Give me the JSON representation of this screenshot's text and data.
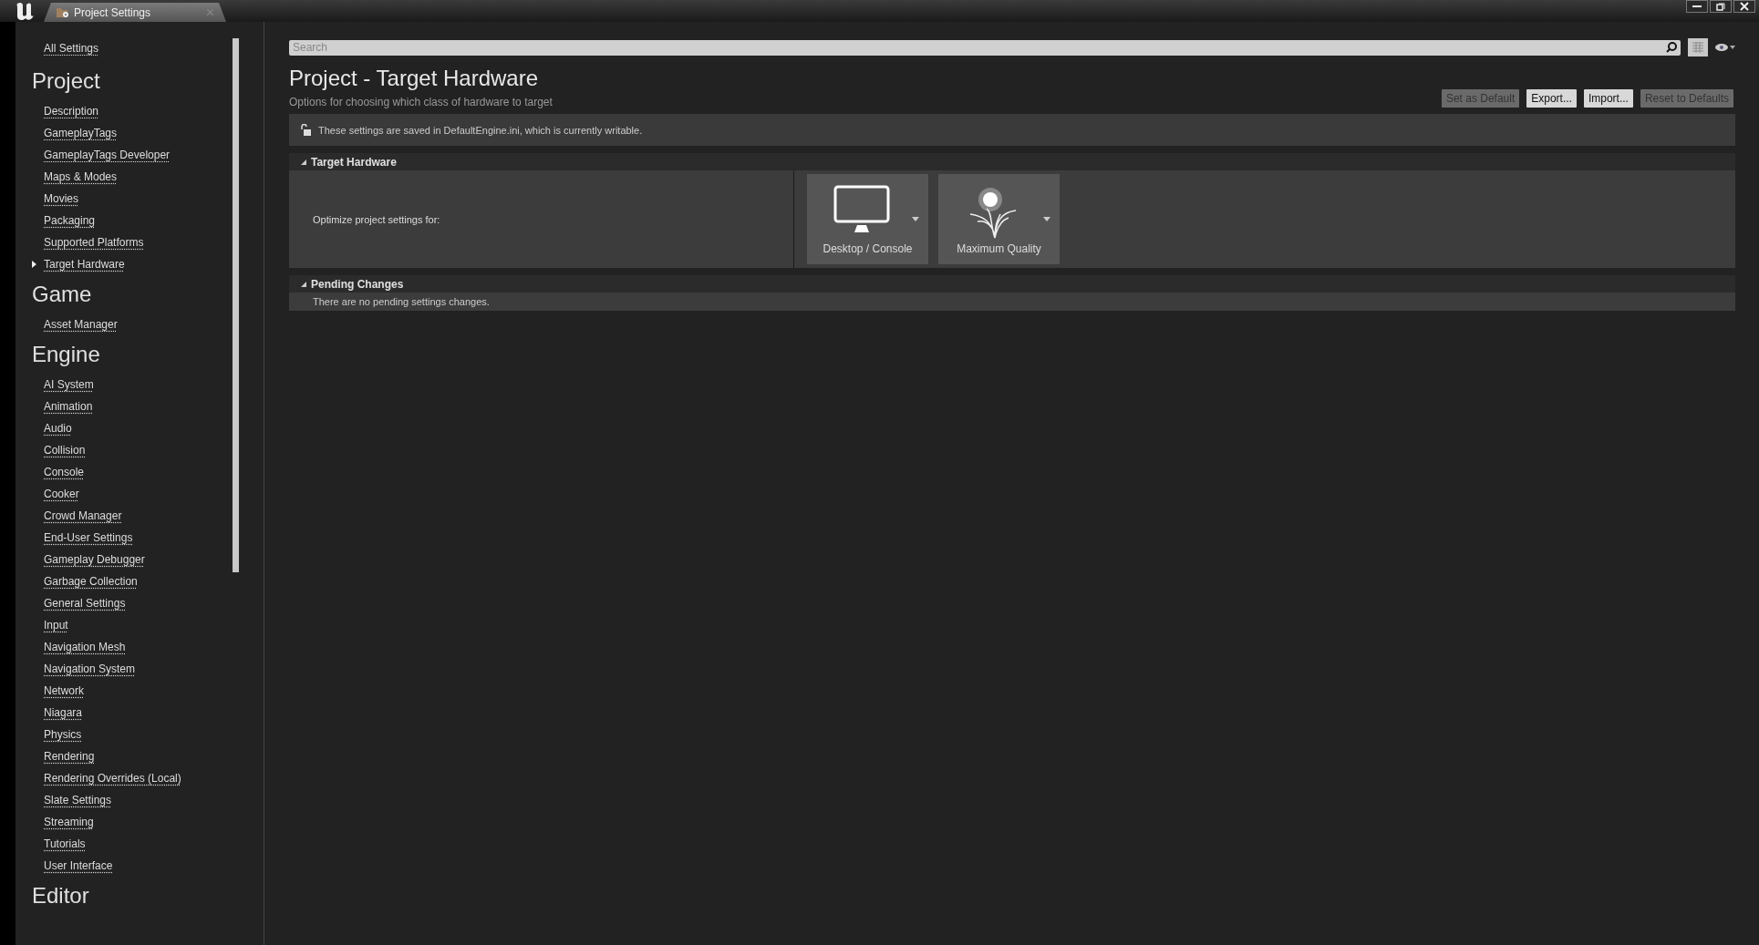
{
  "window": {
    "tab_title": "Project Settings"
  },
  "sidebar": {
    "all_settings": "All Settings",
    "sections": [
      {
        "title": "Project",
        "items": [
          {
            "label": "Description",
            "selected": false
          },
          {
            "label": "GameplayTags",
            "selected": false
          },
          {
            "label": "GameplayTags Developer",
            "selected": false
          },
          {
            "label": "Maps & Modes",
            "selected": false
          },
          {
            "label": "Movies",
            "selected": false
          },
          {
            "label": "Packaging",
            "selected": false
          },
          {
            "label": "Supported Platforms",
            "selected": false
          },
          {
            "label": "Target Hardware",
            "selected": true
          }
        ]
      },
      {
        "title": "Game",
        "items": [
          {
            "label": "Asset Manager",
            "selected": false
          }
        ]
      },
      {
        "title": "Engine",
        "items": [
          {
            "label": "AI System",
            "selected": false
          },
          {
            "label": "Animation",
            "selected": false
          },
          {
            "label": "Audio",
            "selected": false
          },
          {
            "label": "Collision",
            "selected": false
          },
          {
            "label": "Console",
            "selected": false
          },
          {
            "label": "Cooker",
            "selected": false
          },
          {
            "label": "Crowd Manager",
            "selected": false
          },
          {
            "label": "End-User Settings",
            "selected": false
          },
          {
            "label": "Gameplay Debugger",
            "selected": false
          },
          {
            "label": "Garbage Collection",
            "selected": false
          },
          {
            "label": "General Settings",
            "selected": false
          },
          {
            "label": "Input",
            "selected": false
          },
          {
            "label": "Navigation Mesh",
            "selected": false
          },
          {
            "label": "Navigation System",
            "selected": false
          },
          {
            "label": "Network",
            "selected": false
          },
          {
            "label": "Niagara",
            "selected": false
          },
          {
            "label": "Physics",
            "selected": false
          },
          {
            "label": "Rendering",
            "selected": false
          },
          {
            "label": "Rendering Overrides (Local)",
            "selected": false
          },
          {
            "label": "Slate Settings",
            "selected": false
          },
          {
            "label": "Streaming",
            "selected": false
          },
          {
            "label": "Tutorials",
            "selected": false
          },
          {
            "label": "User Interface",
            "selected": false
          }
        ]
      },
      {
        "title": "Editor"
      }
    ]
  },
  "search": {
    "placeholder": "Search"
  },
  "page": {
    "title": "Project - Target Hardware",
    "subtitle": "Options for choosing which class of hardware to target",
    "buttons": [
      {
        "label": "Set as Default",
        "disabled": true
      },
      {
        "label": "Export...",
        "disabled": false
      },
      {
        "label": "Import...",
        "disabled": false
      },
      {
        "label": "Reset to Defaults",
        "disabled": true
      }
    ],
    "notice": "These settings are saved in DefaultEngine.ini, which is currently writable."
  },
  "categories": [
    {
      "kind": "options",
      "title": "Target Hardware",
      "expanded": true,
      "label": "Optimize project settings for:",
      "options": [
        {
          "kind": "monitor",
          "label": "Desktop / Console"
        },
        {
          "kind": "plant",
          "label": "Maximum Quality"
        }
      ]
    },
    {
      "kind": "message",
      "title": "Pending Changes",
      "expanded": true,
      "text": "There are no pending settings changes."
    }
  ]
}
